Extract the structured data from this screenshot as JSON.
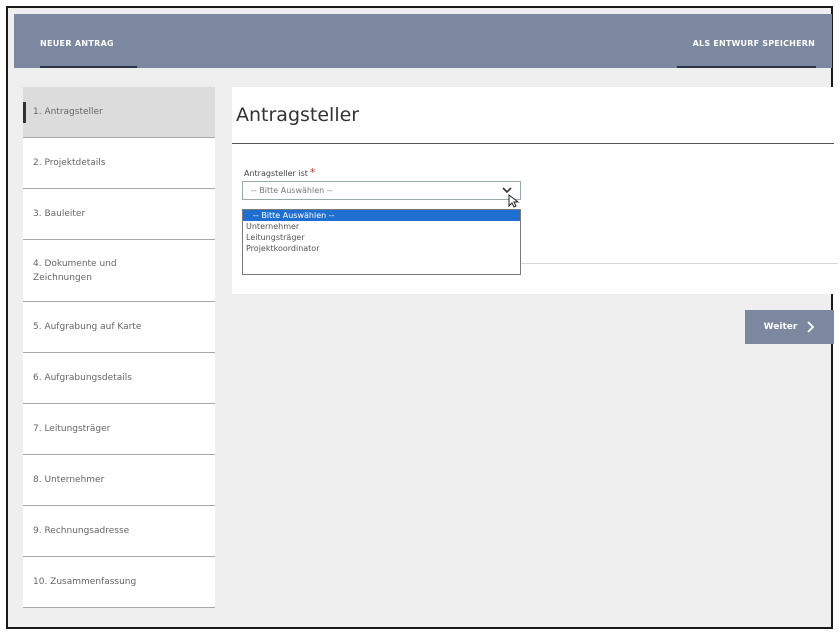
{
  "header": {
    "title": "NEUER ANTRAG",
    "save_draft": "ALS ENTWURF SPEICHERN"
  },
  "steps": [
    {
      "label": "1. Antragsteller",
      "active": true
    },
    {
      "label": "2. Projektdetails"
    },
    {
      "label": "3. Bauleiter"
    },
    {
      "label": "4. Dokumente und\nZeichnungen"
    },
    {
      "label": "5. Aufgrabung auf Karte"
    },
    {
      "label": "6. Aufgrabungsdetails"
    },
    {
      "label": "7. Leitungsträger"
    },
    {
      "label": "8. Unternehmer"
    },
    {
      "label": "9. Rechnungsadresse"
    },
    {
      "label": "10. Zusammenfassung"
    }
  ],
  "form": {
    "title": "Antragsteller",
    "field_label": "Antragsteller ist",
    "required_mark": "*",
    "select_value": "-- Bitte Auswählen --",
    "options": [
      "-- Bitte Auswählen --",
      "Unternehmer",
      "Leitungsträger",
      "Projektkoordinator"
    ],
    "selected_option_index": 0
  },
  "buttons": {
    "next": "Weiter"
  },
  "colors": {
    "header_bg": "#7b88a0",
    "accent_select": "#1e6fd1",
    "required": "#c0392b"
  }
}
